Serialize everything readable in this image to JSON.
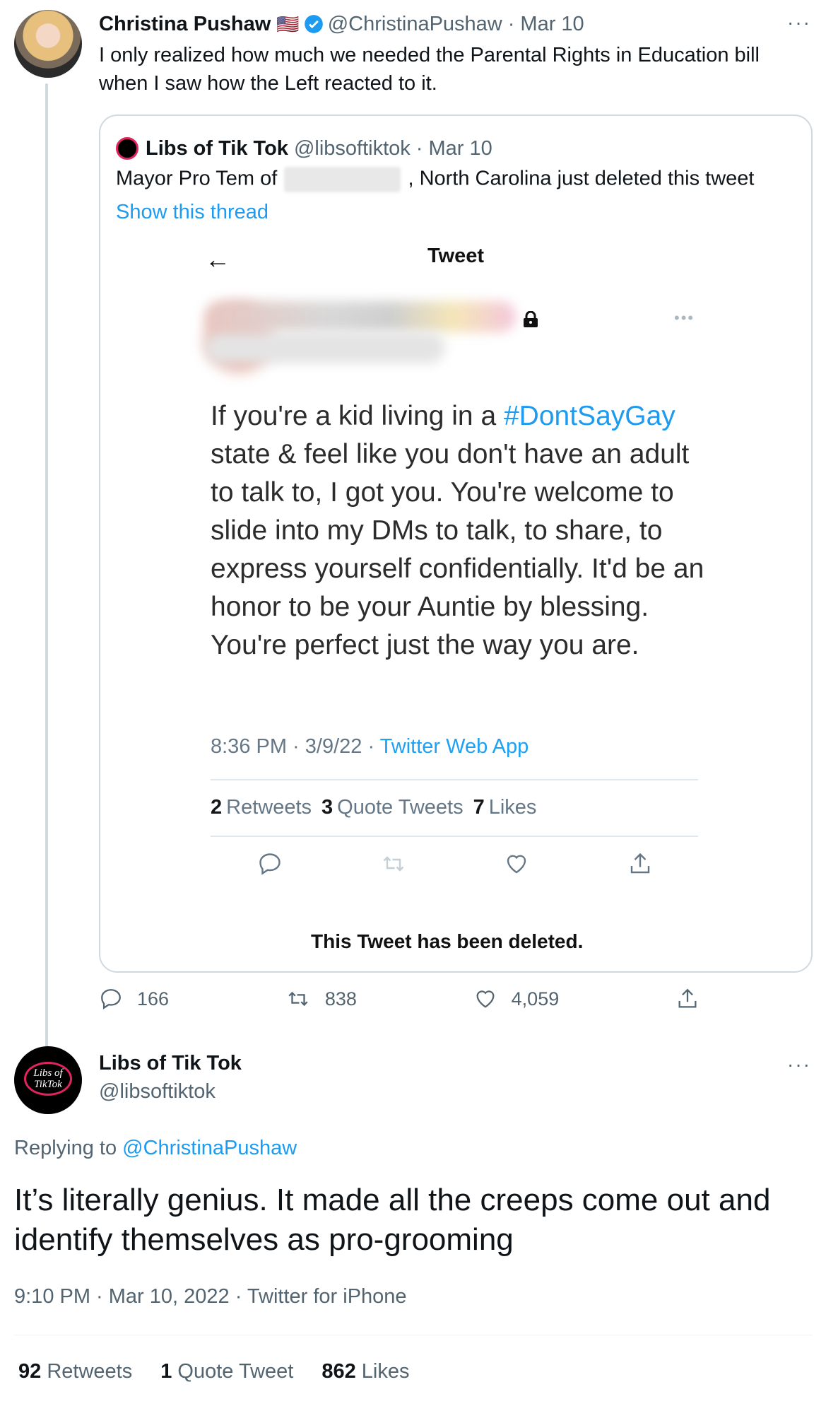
{
  "tweet1": {
    "name": "Christina Pushaw",
    "flag": "🇺🇸",
    "handle": "@ChristinaPushaw",
    "sep": "·",
    "date": "Mar 10",
    "more": "···",
    "text": "I only realized how much we needed the Parental Rights in Education bill when I saw how the Left reacted to it.",
    "actions": {
      "replies": "166",
      "retweets": "838",
      "likes": "4,059"
    }
  },
  "quote": {
    "name": "Libs of Tik Tok",
    "handle": "@libsoftiktok",
    "date": "Mar 10",
    "text_before": "Mayor Pro Tem of",
    "text_after": ", North Carolina just deleted this tweet",
    "show_thread": "Show this thread",
    "screenshot": {
      "back": "←",
      "title": "Tweet",
      "body_before": "If you're a kid living in a ",
      "hashtag": "#DontSayGay",
      "body_after": " state & feel like you don't have an adult to talk to, I got you. You're welcome to slide into my DMs to talk, to share, to express yourself confidentially. It'd be an honor to be your Auntie by blessing. You're perfect just the way you are.",
      "time": "8:36 PM · 3/9/22 · ",
      "source": "Twitter Web App",
      "retweets_count": "2",
      "retweets_label": "Retweets",
      "quotes_count": "3",
      "quotes_label": "Quote Tweets",
      "likes_count": "7",
      "likes_label": "Likes",
      "deleted": "This Tweet has been deleted."
    }
  },
  "tweet2": {
    "name": "Libs of Tik Tok",
    "handle": "@libsoftiktok",
    "avatar_text": "Libs of TikTok",
    "more": "···",
    "replying_label": "Replying to ",
    "replying_handle": "@ChristinaPushaw",
    "text": "It’s literally genius. It made all the creeps come out and identify themselves as pro-grooming",
    "time": "9:10 PM · Mar 10, 2022 · Twitter for iPhone",
    "retweets_count": "92",
    "retweets_label": "Retweets",
    "quotes_count": "1",
    "quotes_label": "Quote Tweet",
    "likes_count": "862",
    "likes_label": "Likes"
  },
  "colors": {
    "link": "#1d9bf0",
    "muted": "#536471",
    "verified": "#1d9bf0",
    "border": "#cfd9de"
  }
}
